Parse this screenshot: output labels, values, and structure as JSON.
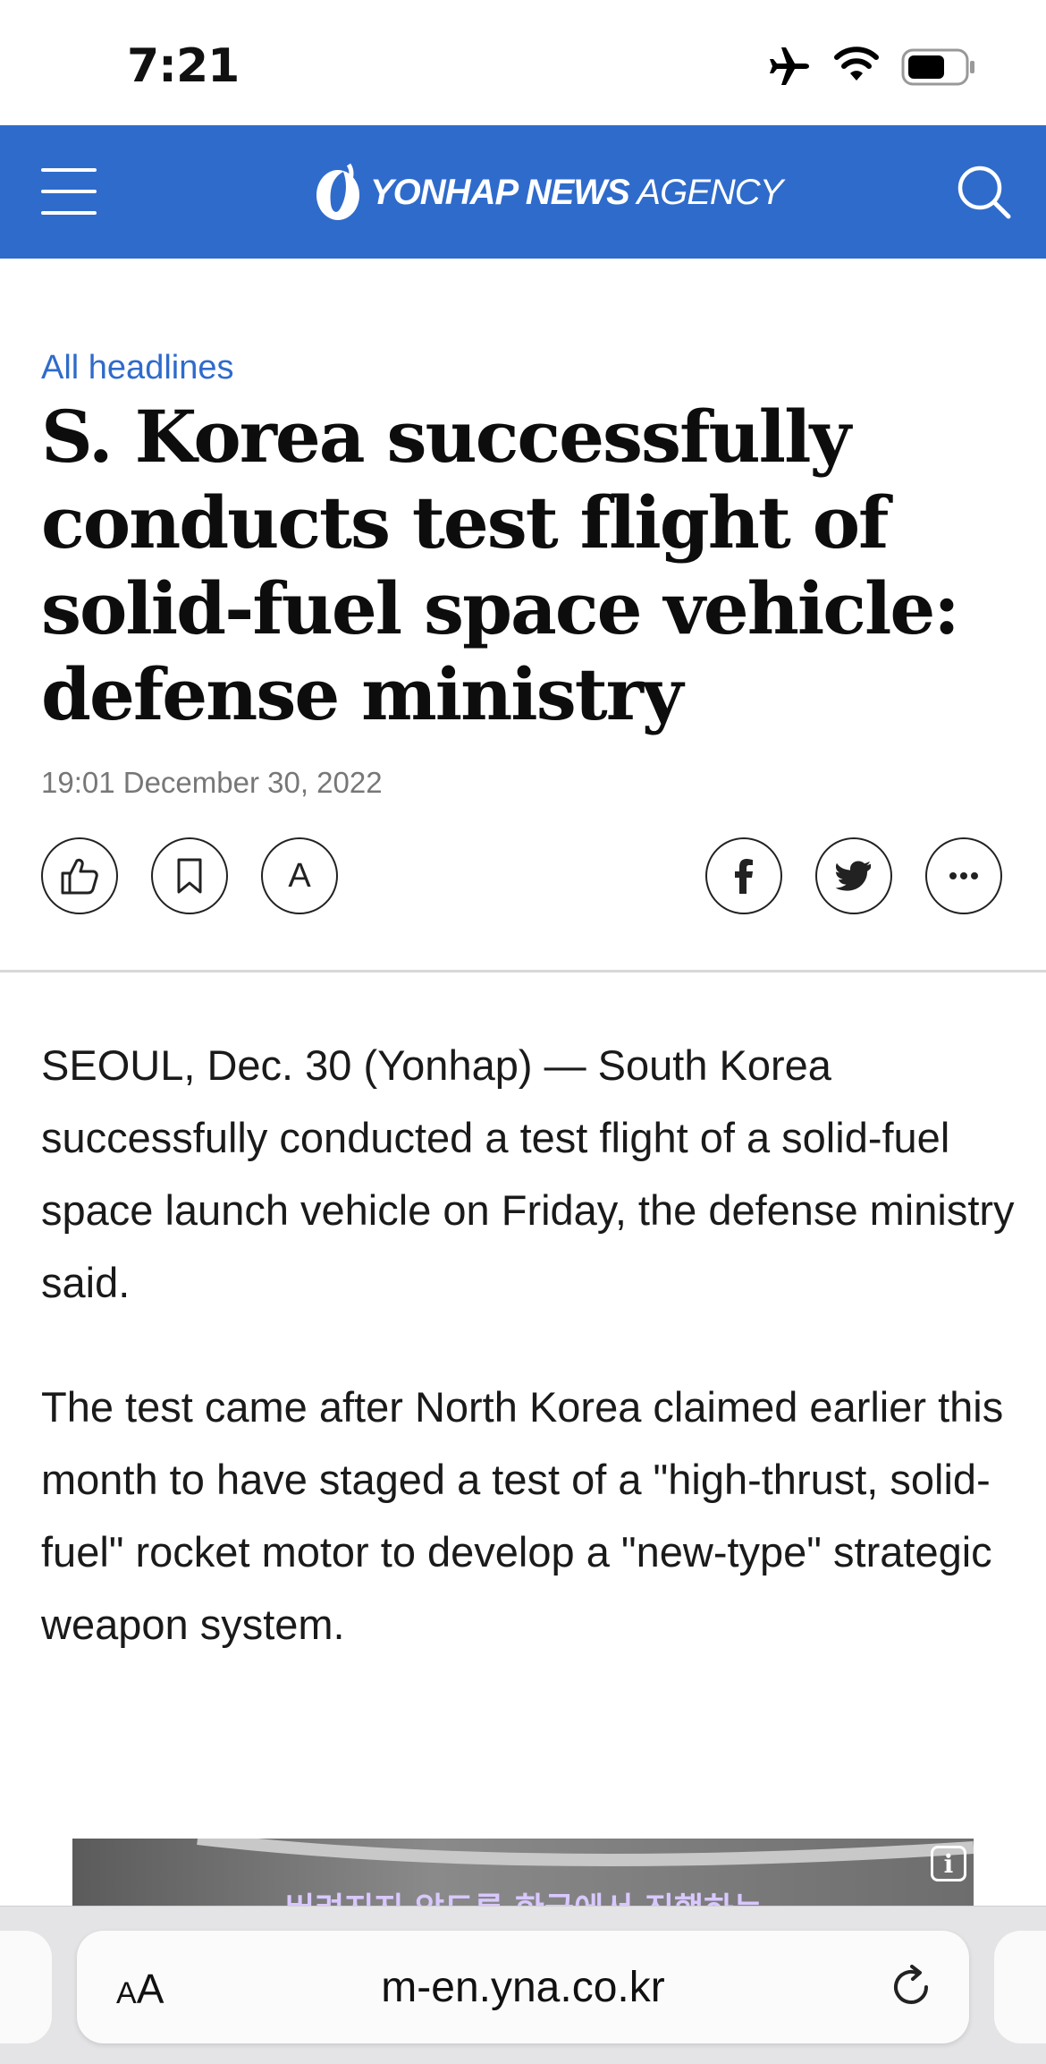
{
  "status_bar": {
    "time": "7:21",
    "icons": [
      "airplane-icon",
      "wifi-icon",
      "battery-icon"
    ]
  },
  "header": {
    "logo_bold": "YONHAP NEWS",
    "logo_light": "AGENCY",
    "icons": [
      "menu-icon",
      "search-icon"
    ],
    "brand_color": "#2f6bcb"
  },
  "article": {
    "kicker": "All headlines",
    "title": "S. Korea successfully conducts test flight of solid-fuel space vehicle: defense ministry",
    "date": "19:01 December 30, 2022",
    "action_icons": [
      "like-icon",
      "bookmark-icon",
      "font-size-icon",
      "facebook-icon",
      "twitter-icon",
      "more-icon"
    ],
    "font_button_label": "A",
    "paragraphs": [
      "SEOUL, Dec. 30 (Yonhap) — South Korea successfully conducted a test flight of a solid-fuel space launch vehicle on Friday, the defense ministry said.",
      "The test came after North Korea claimed earlier this month to have staged a test of a \"high-thrust, solid-fuel\" rocket motor to develop a \"new-type\" strategic weapon system."
    ],
    "media_caption": "버려지지 않도록 한국에서 진행하는",
    "media_info_label": "i"
  },
  "browser": {
    "text_size_label_small": "A",
    "text_size_label_large": "A",
    "url": "m-en.yna.co.kr",
    "icons": [
      "reload-icon"
    ]
  }
}
